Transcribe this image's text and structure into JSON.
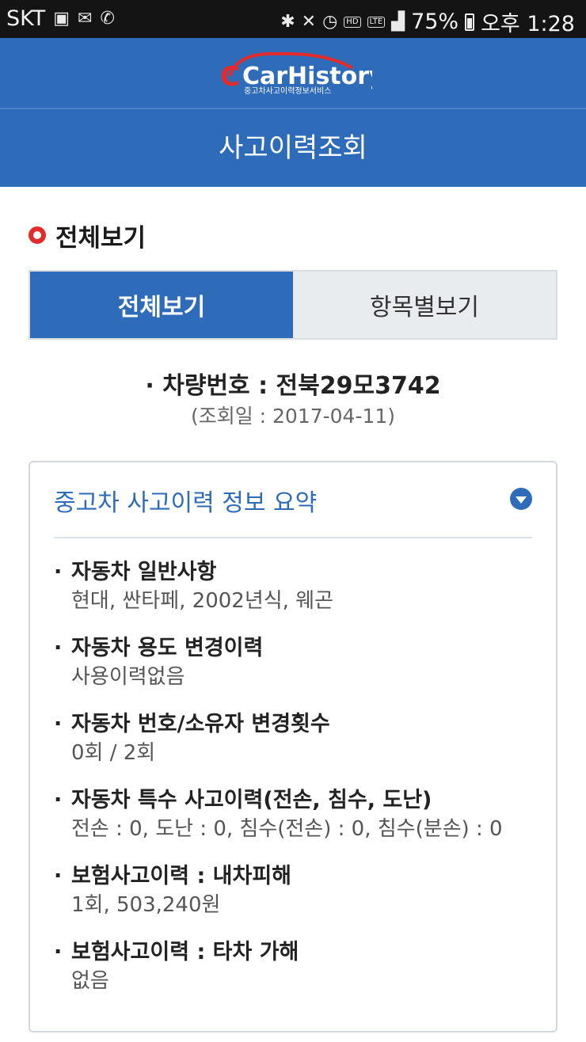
{
  "status_bar": {
    "carrier": "SKT",
    "left_icons": [
      "image-icon",
      "mail-icon",
      "phone-icon"
    ],
    "right_icons": [
      "bluetooth-icon",
      "mute-icon",
      "alarm-icon",
      "hd-voice-icon",
      "lte-icon",
      "signal-icon"
    ],
    "hd_label": "HD",
    "lte_label": "LTE",
    "battery": "75%",
    "time": "오후 1:28"
  },
  "header": {
    "logo_text": "CarHistory",
    "logo_subtitle": "중고차사고이력정보서비스",
    "title": "사고이력조회"
  },
  "section": {
    "title": "전체보기"
  },
  "tabs": [
    {
      "label": "전체보기",
      "active": true
    },
    {
      "label": "항목별보기",
      "active": false
    }
  ],
  "vehicle": {
    "number_line": "· 차량번호 : 전북29모3742",
    "query_date": "(조회일 : 2017-04-11)"
  },
  "summary": {
    "title": "중고차 사고이력 정보 요약",
    "bullet": "·",
    "items": [
      {
        "title": "자동차 일반사항",
        "value": "현대, 싼타페, 2002년식, 웨곤"
      },
      {
        "title": "자동차 용도 변경이력",
        "value": "사용이력없음"
      },
      {
        "title": "자동차 번호/소유자 변경횟수",
        "value": "0회 / 2회"
      },
      {
        "title": "자동차 특수 사고이력(전손, 침수, 도난)",
        "value": "전손 : 0, 도난 : 0, 침수(전손) : 0, 침수(분손) : 0"
      },
      {
        "title": "보험사고이력 : 내차피해",
        "value": "1회, 503,240원"
      },
      {
        "title": "보험사고이력 : 타차 가해",
        "value": "없음"
      }
    ]
  },
  "colors": {
    "brand": "#2e6bb8",
    "accent_red": "#e32b2b"
  }
}
